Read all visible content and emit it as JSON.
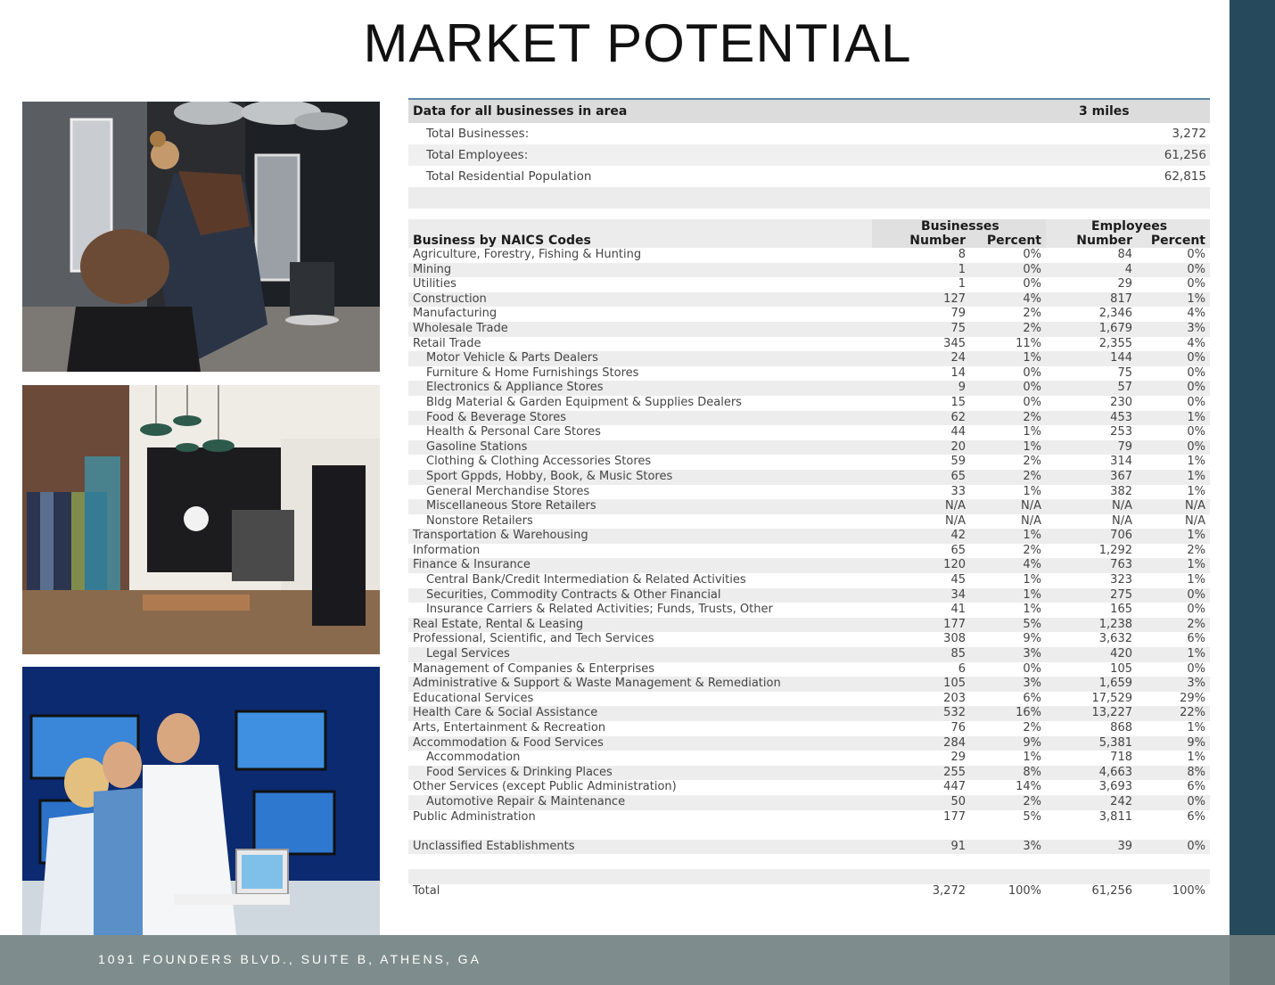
{
  "page": {
    "title": "MARKET POTENTIAL",
    "footer_address": "1091 FOUNDERS BLVD., SUITE B, ATHENS, GA"
  },
  "summary": {
    "header_label": "Data for all businesses in area",
    "header_radius": "3 miles",
    "rows": [
      {
        "label": "Total Businesses:",
        "value": "3,272"
      },
      {
        "label": "Total Employees:",
        "value": "61,256"
      },
      {
        "label": "Total Residential Population",
        "value": "62,815"
      }
    ]
  },
  "naics": {
    "section_label": "Business by NAICS Codes",
    "group_businesses": "Businesses",
    "group_employees": "Employees",
    "col_number": "Number",
    "col_percent": "Percent",
    "rows": [
      {
        "name": "Agriculture, Forestry, Fishing & Hunting",
        "sub": false,
        "bn": "8",
        "bp": "0%",
        "en": "84",
        "ep": "0%"
      },
      {
        "name": "Mining",
        "sub": false,
        "bn": "1",
        "bp": "0%",
        "en": "4",
        "ep": "0%"
      },
      {
        "name": "Utilities",
        "sub": false,
        "bn": "1",
        "bp": "0%",
        "en": "29",
        "ep": "0%"
      },
      {
        "name": "Construction",
        "sub": false,
        "bn": "127",
        "bp": "4%",
        "en": "817",
        "ep": "1%"
      },
      {
        "name": "Manufacturing",
        "sub": false,
        "bn": "79",
        "bp": "2%",
        "en": "2,346",
        "ep": "4%"
      },
      {
        "name": "Wholesale Trade",
        "sub": false,
        "bn": "75",
        "bp": "2%",
        "en": "1,679",
        "ep": "3%"
      },
      {
        "name": "Retail Trade",
        "sub": false,
        "bn": "345",
        "bp": "11%",
        "en": "2,355",
        "ep": "4%"
      },
      {
        "name": "Motor Vehicle & Parts Dealers",
        "sub": true,
        "bn": "24",
        "bp": "1%",
        "en": "144",
        "ep": "0%"
      },
      {
        "name": "Furniture & Home Furnishings Stores",
        "sub": true,
        "bn": "14",
        "bp": "0%",
        "en": "75",
        "ep": "0%"
      },
      {
        "name": "Electronics & Appliance Stores",
        "sub": true,
        "bn": "9",
        "bp": "0%",
        "en": "57",
        "ep": "0%"
      },
      {
        "name": "Bldg Material & Garden Equipment & Supplies Dealers",
        "sub": true,
        "bn": "15",
        "bp": "0%",
        "en": "230",
        "ep": "0%"
      },
      {
        "name": "Food & Beverage Stores",
        "sub": true,
        "bn": "62",
        "bp": "2%",
        "en": "453",
        "ep": "1%"
      },
      {
        "name": "Health & Personal Care Stores",
        "sub": true,
        "bn": "44",
        "bp": "1%",
        "en": "253",
        "ep": "0%"
      },
      {
        "name": "Gasoline Stations",
        "sub": true,
        "bn": "20",
        "bp": "1%",
        "en": "79",
        "ep": "0%"
      },
      {
        "name": "Clothing & Clothing Accessories Stores",
        "sub": true,
        "bn": "59",
        "bp": "2%",
        "en": "314",
        "ep": "1%"
      },
      {
        "name": "Sport Gppds, Hobby, Book, & Music Stores",
        "sub": true,
        "bn": "65",
        "bp": "2%",
        "en": "367",
        "ep": "1%"
      },
      {
        "name": "General Merchandise Stores",
        "sub": true,
        "bn": "33",
        "bp": "1%",
        "en": "382",
        "ep": "1%"
      },
      {
        "name": "Miscellaneous Store Retailers",
        "sub": true,
        "bn": "N/A",
        "bp": "N/A",
        "en": "N/A",
        "ep": "N/A"
      },
      {
        "name": "Nonstore Retailers",
        "sub": true,
        "bn": "N/A",
        "bp": "N/A",
        "en": "N/A",
        "ep": "N/A"
      },
      {
        "name": "Transportation & Warehousing",
        "sub": false,
        "bn": "42",
        "bp": "1%",
        "en": "706",
        "ep": "1%"
      },
      {
        "name": "Information",
        "sub": false,
        "bn": "65",
        "bp": "2%",
        "en": "1,292",
        "ep": "2%"
      },
      {
        "name": "Finance & Insurance",
        "sub": false,
        "bn": "120",
        "bp": "4%",
        "en": "763",
        "ep": "1%"
      },
      {
        "name": "Central Bank/Credit Intermediation & Related Activities",
        "sub": true,
        "bn": "45",
        "bp": "1%",
        "en": "323",
        "ep": "1%"
      },
      {
        "name": "Securities, Commodity Contracts & Other Financial",
        "sub": true,
        "bn": "34",
        "bp": "1%",
        "en": "275",
        "ep": "0%"
      },
      {
        "name": "Insurance Carriers & Related Activities; Funds, Trusts, Other",
        "sub": true,
        "bn": "41",
        "bp": "1%",
        "en": "165",
        "ep": "0%"
      },
      {
        "name": "Real Estate, Rental & Leasing",
        "sub": false,
        "bn": "177",
        "bp": "5%",
        "en": "1,238",
        "ep": "2%"
      },
      {
        "name": "Professional, Scientific, and Tech Services",
        "sub": false,
        "bn": "308",
        "bp": "9%",
        "en": "3,632",
        "ep": "6%"
      },
      {
        "name": "Legal Services",
        "sub": true,
        "bn": "85",
        "bp": "3%",
        "en": "420",
        "ep": "1%"
      },
      {
        "name": "Management of Companies & Enterprises",
        "sub": false,
        "bn": "6",
        "bp": "0%",
        "en": "105",
        "ep": "0%"
      },
      {
        "name": "Administrative & Support & Waste Management & Remediation",
        "sub": false,
        "bn": "105",
        "bp": "3%",
        "en": "1,659",
        "ep": "3%"
      },
      {
        "name": "Educational Services",
        "sub": false,
        "bn": "203",
        "bp": "6%",
        "en": "17,529",
        "ep": "29%"
      },
      {
        "name": "Health Care & Social Assistance",
        "sub": false,
        "bn": "532",
        "bp": "16%",
        "en": "13,227",
        "ep": "22%"
      },
      {
        "name": "Arts, Entertainment & Recreation",
        "sub": false,
        "bn": "76",
        "bp": "2%",
        "en": "868",
        "ep": "1%"
      },
      {
        "name": "Accommodation & Food Services",
        "sub": false,
        "bn": "284",
        "bp": "9%",
        "en": "5,381",
        "ep": "9%"
      },
      {
        "name": "Accommodation",
        "sub": true,
        "bn": "29",
        "bp": "1%",
        "en": "718",
        "ep": "1%"
      },
      {
        "name": "Food Services & Drinking Places",
        "sub": true,
        "bn": "255",
        "bp": "8%",
        "en": "4,663",
        "ep": "8%"
      },
      {
        "name": "Other Services (except Public Administration)",
        "sub": false,
        "bn": "447",
        "bp": "14%",
        "en": "3,693",
        "ep": "6%"
      },
      {
        "name": "Automotive Repair & Maintenance",
        "sub": true,
        "bn": "50",
        "bp": "2%",
        "en": "242",
        "ep": "0%"
      },
      {
        "name": "Public Administration",
        "sub": false,
        "bn": "177",
        "bp": "5%",
        "en": "3,811",
        "ep": "6%"
      }
    ],
    "unclassified": {
      "name": "Unclassified Establishments",
      "bn": "91",
      "bp": "3%",
      "en": "39",
      "ep": "0%"
    },
    "total": {
      "name": "Total",
      "bn": "3,272",
      "bp": "100%",
      "en": "61,256",
      "ep": "100%"
    }
  },
  "colors": {
    "sidebar": "#264a5c",
    "footer": "#7f8c8d",
    "table_header": "#dcdcdc",
    "table_rule": "#5a87a8"
  }
}
